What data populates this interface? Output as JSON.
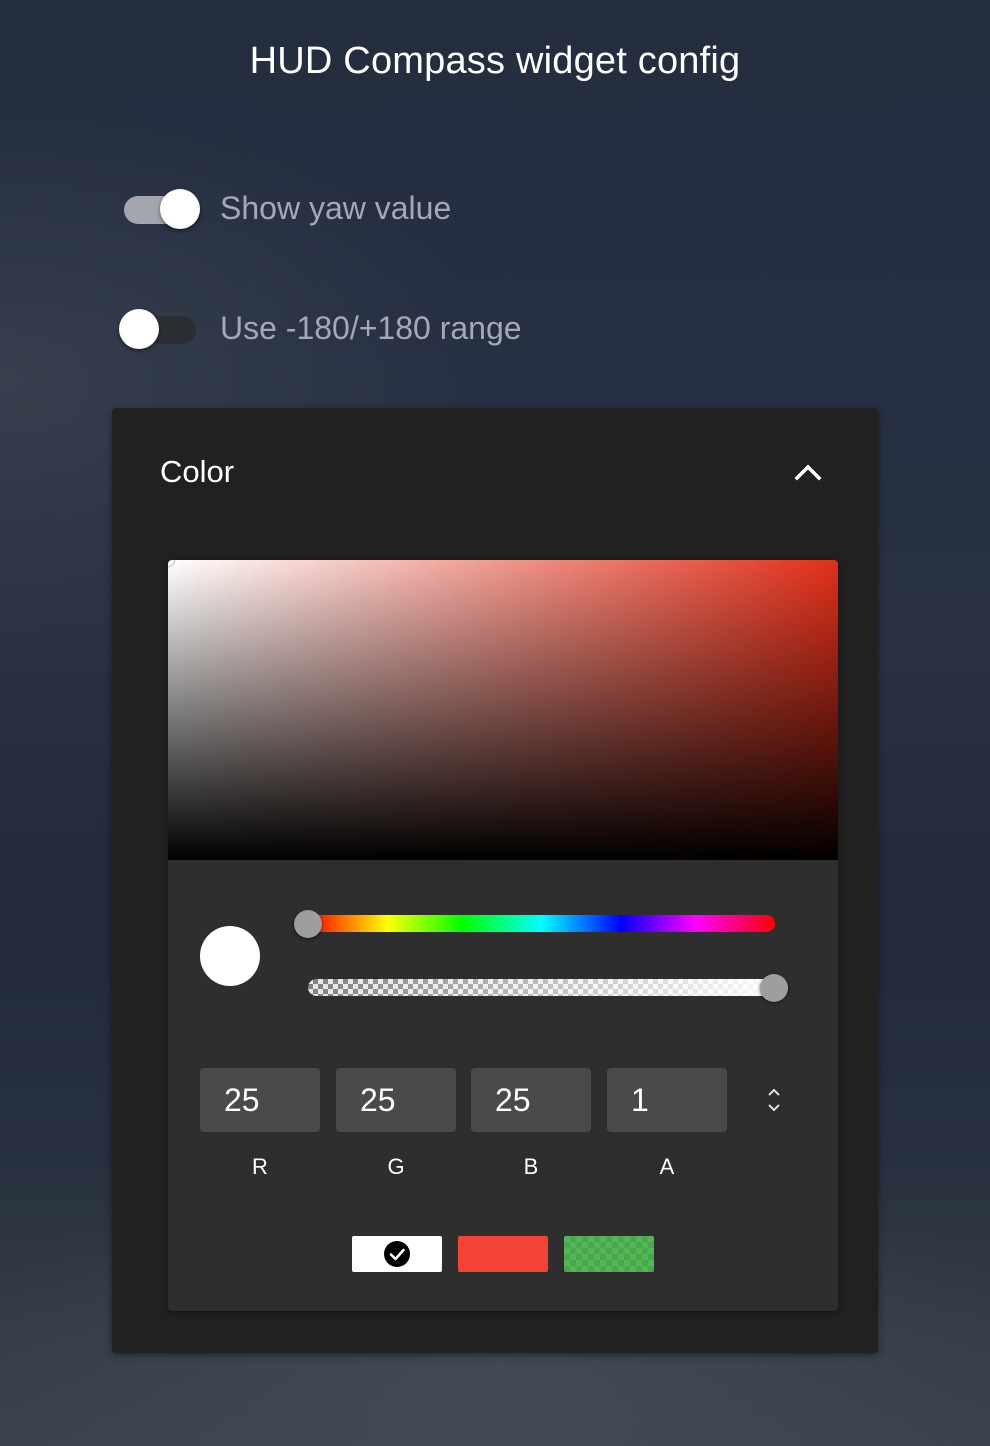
{
  "header": {
    "title": "HUD Compass widget config"
  },
  "toggles": [
    {
      "label": "Show yaw value",
      "checked": true
    },
    {
      "label": "Use -180/+180 range",
      "checked": false
    }
  ],
  "color_panel": {
    "title": "Color",
    "expanded": true,
    "collapse_icon": "chevron-up-icon",
    "picker": {
      "base_hue_color": "#e2301a",
      "current_color": "#ffffff",
      "hue_level": 0,
      "alpha_level": 1,
      "channels": [
        {
          "label": "R",
          "value": "25"
        },
        {
          "label": "G",
          "value": "25"
        },
        {
          "label": "B",
          "value": "25"
        },
        {
          "label": "A",
          "value": "1"
        }
      ],
      "mode_toggle_icon": "unfold-icon",
      "presets": [
        {
          "name": "white",
          "color": "#ffffff",
          "selected": true,
          "icon": "check-circle-icon"
        },
        {
          "name": "red",
          "color": "#f44336",
          "selected": false
        },
        {
          "name": "translucent-green",
          "color": "#4caf50",
          "selected": false
        }
      ]
    }
  }
}
